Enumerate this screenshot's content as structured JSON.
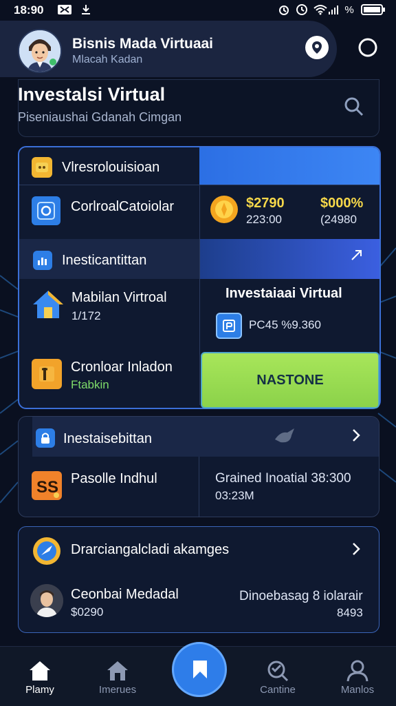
{
  "status_bar": {
    "time": "18:90",
    "battery_text": "%"
  },
  "header": {
    "title": "Bisnis Mada Virtuaai",
    "subtitle": "Mlacah Kadan"
  },
  "section": {
    "title": "Investalsi Virtual",
    "search_hint": "Piseniaushai Gdanah Cimgan"
  },
  "card1": {
    "rows": [
      {
        "label": "Vlresrolouisioan"
      },
      {
        "label": "CorlroalCatoiolar"
      },
      {
        "label": "Inesticantittan"
      },
      {
        "label": "Mabilan Virtroal",
        "value": "1/172"
      },
      {
        "label": "Cronloar Inladon",
        "value": "Ftabkin"
      }
    ],
    "stats": {
      "value_a": "$2790",
      "sub_a": "223:00",
      "value_b": "$000%",
      "sub_b": "(24980"
    },
    "right_title": "Investaiaai Virtual",
    "right_amount": "PC45 %9.360",
    "cta_label": "NASTONE"
  },
  "card2": {
    "header_label": "Inestaisebittan",
    "row_label": "Pasolle Indhul",
    "right_title": "Grained Inoatial 38:300",
    "right_value": "03:23M"
  },
  "card3": {
    "header_label": "Drarciangalcladi akamges",
    "person_name": "Ceonbai Medadal",
    "person_value": "$0290",
    "right_title": "Dinoebasag 8 iolarair",
    "right_value": "8493"
  },
  "nav": [
    {
      "label": "Plamy"
    },
    {
      "label": "Imerues"
    },
    {
      "label": "Cantine"
    },
    {
      "label": "Manlos"
    }
  ],
  "colors": {
    "accent": "#2e7de9",
    "cta": "#9ddc52",
    "gold": "#f6d84a",
    "card_border": "#3b6fd8"
  }
}
